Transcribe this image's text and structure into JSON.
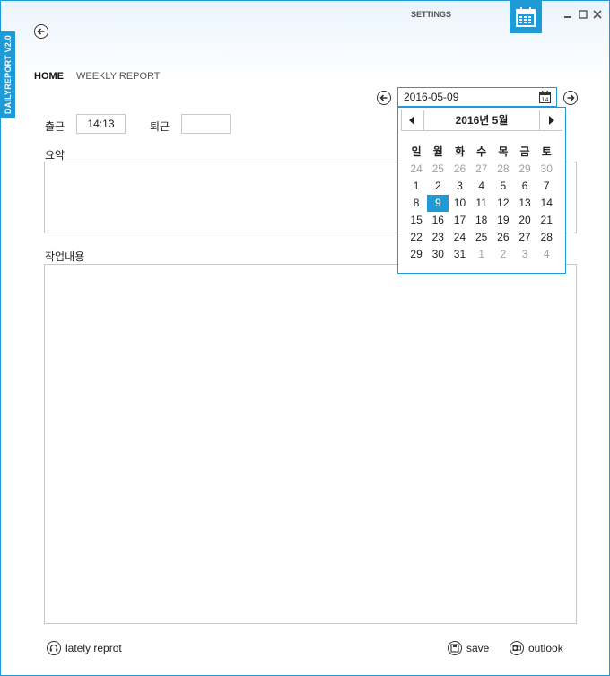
{
  "app": {
    "side_label": "DAILYREPORT V2.0",
    "settings_label": "SETTINGS"
  },
  "nav": {
    "home": "HOME",
    "weekly_report": "WEEKLY REPORT"
  },
  "date": {
    "value": "2016-05-09",
    "picker_icon": "14"
  },
  "calendar": {
    "title": "2016년 5월",
    "weekdays": [
      "일",
      "월",
      "화",
      "수",
      "목",
      "금",
      "토"
    ],
    "days": [
      "24",
      "25",
      "26",
      "27",
      "28",
      "29",
      "30",
      "1",
      "2",
      "3",
      "4",
      "5",
      "6",
      "7",
      "8",
      "9",
      "10",
      "11",
      "12",
      "13",
      "14",
      "15",
      "16",
      "17",
      "18",
      "19",
      "20",
      "21",
      "22",
      "23",
      "24",
      "25",
      "26",
      "27",
      "28",
      "29",
      "30",
      "31",
      "1",
      "2",
      "3",
      "4"
    ],
    "selected_day": "9",
    "accent": "#1e9ad6"
  },
  "form": {
    "check_in_label": "출근",
    "check_in_value": "14:13",
    "check_out_label": "퇴근",
    "check_out_value": "",
    "summary_label": "요약",
    "work_label": "작업내용"
  },
  "footer": {
    "lately": "lately reprot",
    "save": "save",
    "outlook": "outlook"
  },
  "icons": {
    "back": "back-arrow-icon",
    "calendar_app": "calendar-icon",
    "prev_day": "left-arrow-icon",
    "next_day": "right-arrow-icon"
  }
}
